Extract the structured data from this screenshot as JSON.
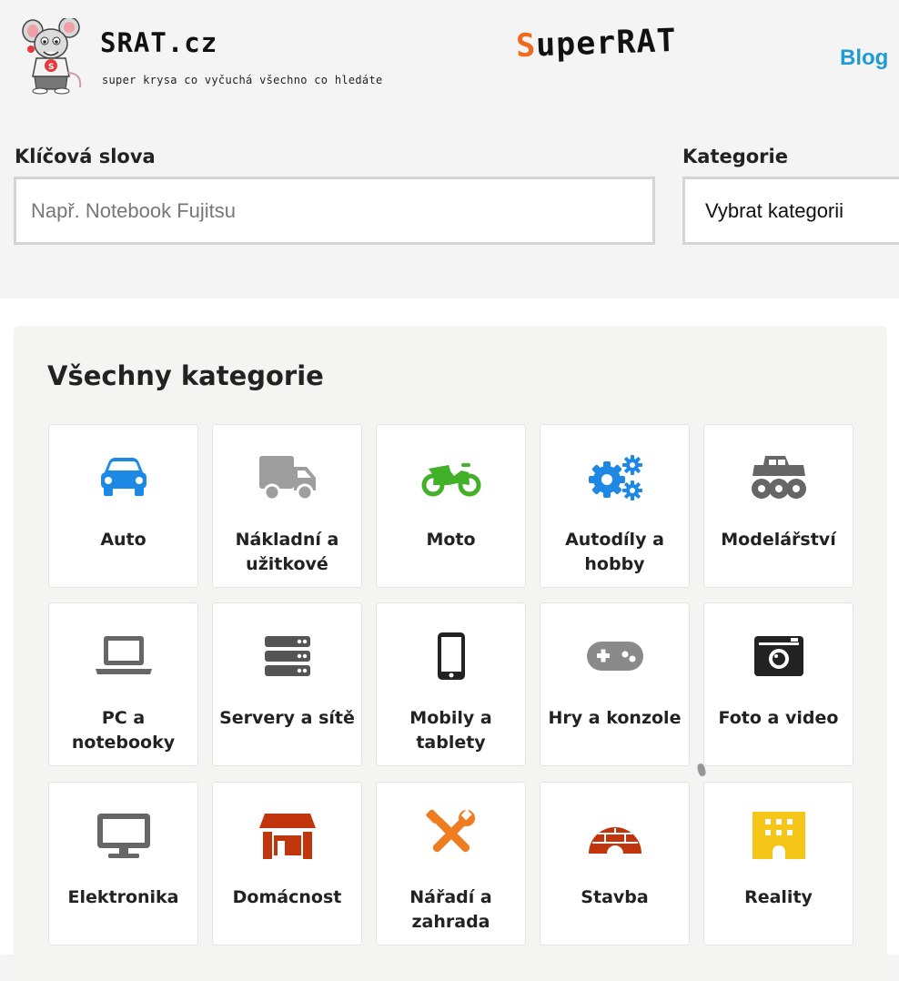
{
  "header": {
    "logo_text": "SRAT.cz",
    "tagline": "super krysa co vyčuchá všechno co hledáte",
    "brand_prefix": "S",
    "brand_rest": "uperRAT",
    "blog_label": "Blog"
  },
  "search": {
    "keywords_label": "Klíčová slova",
    "keywords_placeholder": "Např. Notebook Fujitsu",
    "keywords_value": "",
    "category_label": "Kategorie",
    "category_value": "Vybrat kategorii"
  },
  "categories": {
    "title": "Všechny kategorie",
    "items": [
      {
        "label": "Auto",
        "icon": "car-icon",
        "color": "#1e88e5"
      },
      {
        "label": "Nákladní a užitkové",
        "icon": "truck-icon",
        "color": "#9e9e9e"
      },
      {
        "label": "Moto",
        "icon": "motorcycle-icon",
        "color": "#43b02a"
      },
      {
        "label": "Autodíly a hobby",
        "icon": "gears-icon",
        "color": "#1e88e5"
      },
      {
        "label": "Modelářství",
        "icon": "monster-truck-icon",
        "color": "#666666"
      },
      {
        "label": "PC a notebooky",
        "icon": "laptop-icon",
        "color": "#666666"
      },
      {
        "label": "Servery a sítě",
        "icon": "server-icon",
        "color": "#555555"
      },
      {
        "label": "Mobily a tablety",
        "icon": "phone-icon",
        "color": "#222222"
      },
      {
        "label": "Hry a konzole",
        "icon": "gamepad-icon",
        "color": "#8a8a8a"
      },
      {
        "label": "Foto a video",
        "icon": "camera-icon",
        "color": "#222222"
      },
      {
        "label": "Elektronika",
        "icon": "monitor-icon",
        "color": "#666666"
      },
      {
        "label": "Domácnost",
        "icon": "store-icon",
        "color": "#c0350b"
      },
      {
        "label": "Nářadí a zahrada",
        "icon": "tools-icon",
        "color": "#f07c22"
      },
      {
        "label": "Stavba",
        "icon": "igloo-icon",
        "color": "#c0350b"
      },
      {
        "label": "Reality",
        "icon": "building-icon",
        "color": "#f5c518"
      }
    ]
  }
}
